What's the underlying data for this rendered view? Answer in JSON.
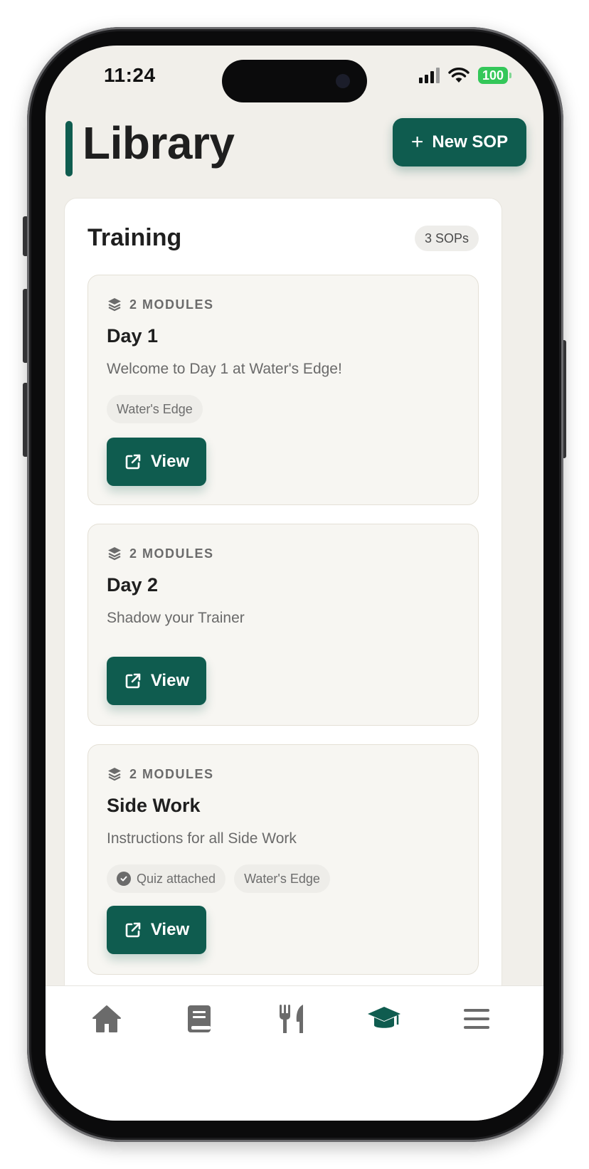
{
  "status": {
    "time": "11:24",
    "battery": "100"
  },
  "header": {
    "title": "Library",
    "new_button": "New SOP"
  },
  "section": {
    "title": "Training",
    "count": "3 SOPs"
  },
  "cards": [
    {
      "modules": "2 MODULES",
      "title": "Day 1",
      "description": "Welcome to Day 1 at Water's Edge!",
      "tags": [
        "Water's Edge"
      ],
      "button": "View"
    },
    {
      "modules": "2 MODULES",
      "title": "Day 2",
      "description": "Shadow your Trainer",
      "tags": [],
      "button": "View"
    },
    {
      "modules": "2 MODULES",
      "title": "Side Work",
      "description": "Instructions for all Side Work",
      "quiz_tag": "Quiz attached",
      "tags": [
        "Water's Edge"
      ],
      "button": "View"
    }
  ],
  "nav": {
    "items": [
      "home-icon",
      "book-icon",
      "utensils-icon",
      "graduation-cap-icon",
      "menu-icon"
    ],
    "active": "graduation-cap-icon"
  },
  "colors": {
    "accent": "#0f5c4f",
    "background": "#f1efea",
    "card": "#f7f6f2",
    "nav_inactive": "#6b6b6b"
  }
}
